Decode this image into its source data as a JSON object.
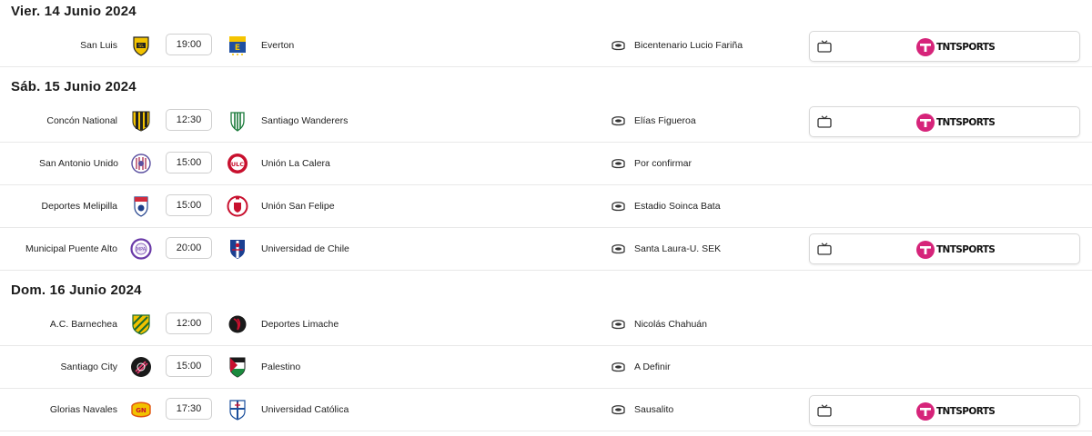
{
  "colors": {
    "tnt_brand": "#d6247a",
    "header_text": "#1b1b1b",
    "divider": "#e8e8e8"
  },
  "days": [
    {
      "date": "Vier. 14 Junio 2024",
      "matches": [
        {
          "home": "San Luis",
          "time": "19:00",
          "away": "Everton",
          "stadium": "Bicentenario Lucio Fariña",
          "broadcaster": "TNTSPORTS"
        }
      ]
    },
    {
      "date": "Sáb. 15 Junio 2024",
      "matches": [
        {
          "home": "Concón National",
          "time": "12:30",
          "away": "Santiago Wanderers",
          "stadium": "Elías Figueroa",
          "broadcaster": "TNTSPORTS"
        },
        {
          "home": "San Antonio Unido",
          "time": "15:00",
          "away": "Unión La Calera",
          "stadium": "Por confirmar",
          "broadcaster": null
        },
        {
          "home": "Deportes Melipilla",
          "time": "15:00",
          "away": "Unión San Felipe",
          "stadium": "Estadio Soinca Bata",
          "broadcaster": null
        },
        {
          "home": "Municipal Puente Alto",
          "time": "20:00",
          "away": "Universidad de Chile",
          "stadium": "Santa Laura-U. SEK",
          "broadcaster": "TNTSPORTS"
        }
      ]
    },
    {
      "date": "Dom. 16 Junio 2024",
      "matches": [
        {
          "home": "A.C. Barnechea",
          "time": "12:00",
          "away": "Deportes Limache",
          "stadium": "Nicolás Chahuán",
          "broadcaster": null
        },
        {
          "home": "Santiago City",
          "time": "15:00",
          "away": "Palestino",
          "stadium": "A Definir",
          "broadcaster": null
        },
        {
          "home": "Glorias Navales",
          "time": "17:30",
          "away": "Universidad Católica",
          "stadium": "Sausalito",
          "broadcaster": "TNTSPORTS"
        }
      ]
    }
  ]
}
